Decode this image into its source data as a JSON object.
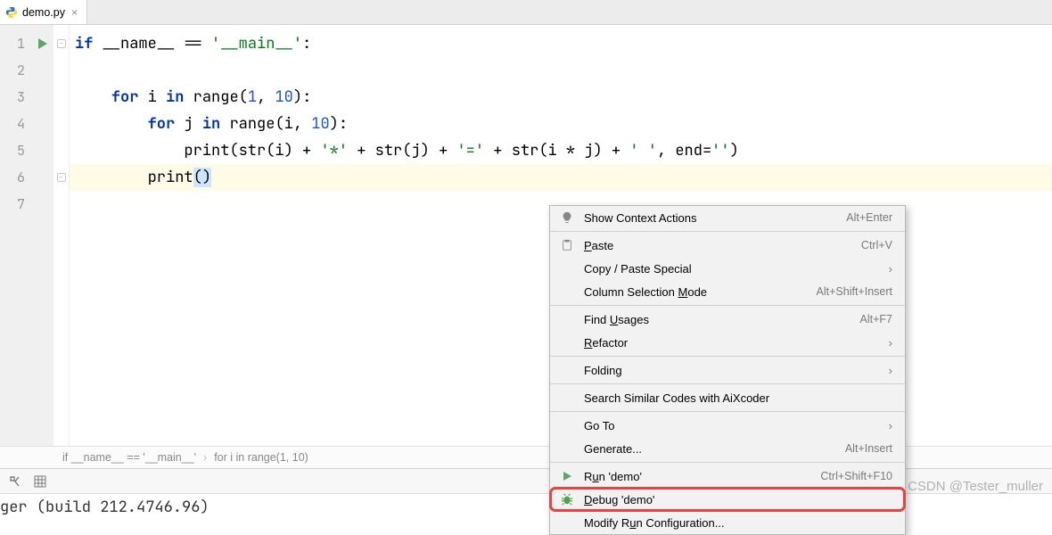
{
  "tab": {
    "file": "demo.py"
  },
  "gutter": {
    "lines": [
      "1",
      "2",
      "3",
      "4",
      "5",
      "6",
      "7"
    ]
  },
  "code": {
    "l1": {
      "kw_if": "if",
      "name": "__name__",
      "eq": "==",
      "str": "'__main__'",
      "colon": ":"
    },
    "l3": {
      "kw_for": "for",
      "var": "i",
      "kw_in": "in",
      "fn": "range",
      "lp": "(",
      "n1": "1",
      "comma": ", ",
      "n2": "10",
      "rp": ")",
      "colon": ":"
    },
    "l4": {
      "kw_for": "for",
      "var": "j",
      "kw_in": "in",
      "fn": "range",
      "lp": "(",
      "v": "i",
      "comma": ", ",
      "n2": "10",
      "rp": ")",
      "colon": ":"
    },
    "l5": {
      "fn_print": "print",
      "lp": "(",
      "fn_str": "str",
      "lp2": "(",
      "i": "i",
      "rp2": ")",
      "plus": " + ",
      "s_star": "'*'",
      "plus2": " + ",
      "fn_str2": "str",
      "lp3": "(",
      "j": "j",
      "rp3": ")",
      "plus3": " + ",
      "s_eq": "'='",
      "plus4": " + ",
      "fn_str3": "str",
      "lp4": "(",
      "i2": "i",
      "mul": " * ",
      "j2": "j",
      "rp4": ")",
      "plus5": " + ",
      "s_sp": "' '",
      "comma": ", ",
      "end": "end",
      "assign": "=",
      "s_empty": "''",
      "rp": ")"
    },
    "l6": {
      "fn_print": "print",
      "lp": "(",
      "rp": ")"
    }
  },
  "breadcrumb": {
    "a": "if __name__ == '__main__'",
    "b": "for i in range(1, 10)"
  },
  "status": {
    "text": "ger (build 212.4746.96)"
  },
  "context_menu": {
    "show_context_actions": "Show Context Actions",
    "show_context_actions_sc": "Alt+Enter",
    "paste": "aste",
    "paste_mn": "P",
    "paste_sc": "Ctrl+V",
    "copy_paste_special": "Copy / Paste Special",
    "column_mode_a": "Column Selection ",
    "column_mode_mn": "M",
    "column_mode_b": "ode",
    "column_mode_sc": "Alt+Shift+Insert",
    "find_usages_a": "Find ",
    "find_usages_mn": "U",
    "find_usages_b": "sages",
    "find_usages_sc": "Alt+F7",
    "refactor": "efactor",
    "refactor_mn": "R",
    "folding": "Folding",
    "aixcoder": "Search Similar Codes with AiXcoder",
    "goto": "Go To",
    "generate": "Generate...",
    "generate_sc": "Alt+Insert",
    "run_a": "R",
    "run_mn": "u",
    "run_b": "n 'demo'",
    "run_sc": "Ctrl+Shift+F10",
    "debug_mn": "D",
    "debug": "ebug 'demo'",
    "modify": "Modify R",
    "modify_mn": "u",
    "modify_b": "n Configuration..."
  },
  "watermark": "CSDN @Tester_muller"
}
